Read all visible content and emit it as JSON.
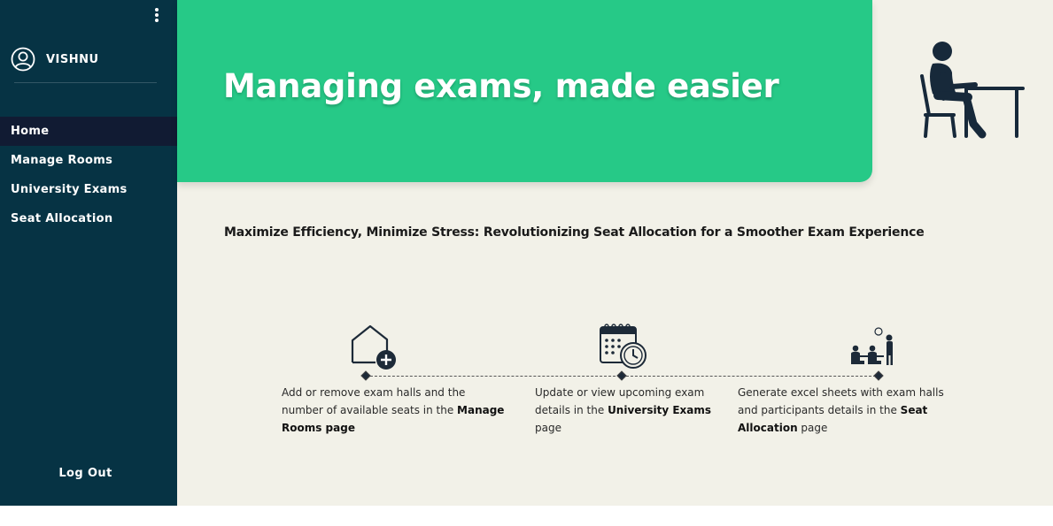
{
  "sidebar": {
    "user_name": "VISHNU",
    "nav_items": [
      {
        "label": "Home",
        "active": true
      },
      {
        "label": "Manage Rooms",
        "active": false
      },
      {
        "label": "University Exams",
        "active": false
      },
      {
        "label": "Seat Allocation",
        "active": false
      }
    ],
    "logout_label": "Log Out",
    "menu_icon": "vertical-dots-icon",
    "user_icon": "user-circle-icon"
  },
  "hero": {
    "title": "Managing exams, made easier",
    "illustration_icon": "person-at-desk-icon"
  },
  "tagline": "Maximize Efficiency, Minimize Stress: Revolutionizing Seat Allocation for a Smoother Exam Experience",
  "steps": [
    {
      "icon": "add-room-icon",
      "text_before": "Add or remove exam halls and the number of available seats in the ",
      "link_text": "Manage Rooms page",
      "text_after": ""
    },
    {
      "icon": "calendar-clock-icon",
      "text_before": "Update or view upcoming exam details in the ",
      "link_text": "University Exams",
      "text_after": " page"
    },
    {
      "icon": "exam-hall-icon",
      "text_before": "Generate excel sheets with exam halls and participants details in the ",
      "link_text": "Seat Allocation",
      "text_after": " page"
    }
  ],
  "colors": {
    "sidebar_bg": "#063344",
    "active_nav_bg": "#111b33",
    "hero_bg": "#26c987",
    "main_bg": "#f2f1e8",
    "icon_dark": "#1d2a38"
  }
}
